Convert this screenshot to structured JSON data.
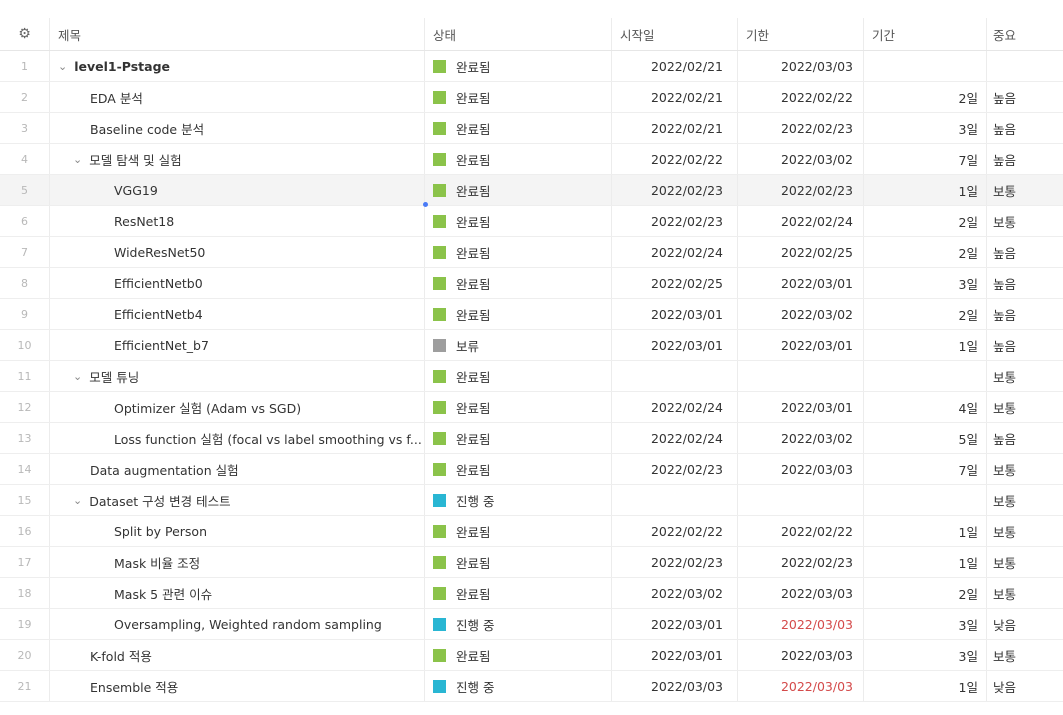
{
  "columns": {
    "settings_icon": "gear-icon",
    "title": "제목",
    "status": "상태",
    "start": "시작일",
    "due": "기한",
    "duration": "기간",
    "priority": "중요"
  },
  "colors": {
    "done": "#8bc34a",
    "hold": "#9e9e9e",
    "progress": "#29b6d3",
    "overdue": "#d44a4a"
  },
  "rows": [
    {
      "num": "1",
      "title": "level1-Pstage",
      "indent": 0,
      "chevron": true,
      "bold": true,
      "status": "완료됨",
      "status_color": "done",
      "start": "2022/02/21",
      "due": "2022/03/03",
      "duration": "",
      "priority": ""
    },
    {
      "num": "2",
      "title": "EDA 분석",
      "indent": 1,
      "chevron": false,
      "status": "완료됨",
      "status_color": "done",
      "start": "2022/02/21",
      "due": "2022/02/22",
      "duration": "2일",
      "priority": "높음"
    },
    {
      "num": "3",
      "title": "Baseline code 분석",
      "indent": 1,
      "chevron": false,
      "status": "완료됨",
      "status_color": "done",
      "start": "2022/02/21",
      "due": "2022/02/23",
      "duration": "3일",
      "priority": "높음"
    },
    {
      "num": "4",
      "title": "모델 탐색 및 실험",
      "indent": 1,
      "chevron": true,
      "status": "완료됨",
      "status_color": "done",
      "start": "2022/02/22",
      "due": "2022/03/02",
      "duration": "7일",
      "priority": "높음"
    },
    {
      "num": "5",
      "title": "VGG19",
      "indent": 2,
      "chevron": false,
      "highlight": true,
      "status": "완료됨",
      "status_color": "done",
      "start": "2022/02/23",
      "due": "2022/02/23",
      "duration": "1일",
      "priority": "보통"
    },
    {
      "num": "6",
      "title": "ResNet18",
      "indent": 2,
      "chevron": false,
      "status": "완료됨",
      "status_color": "done",
      "start": "2022/02/23",
      "due": "2022/02/24",
      "duration": "2일",
      "priority": "보통"
    },
    {
      "num": "7",
      "title": "WideResNet50",
      "indent": 2,
      "chevron": false,
      "status": "완료됨",
      "status_color": "done",
      "start": "2022/02/24",
      "due": "2022/02/25",
      "duration": "2일",
      "priority": "높음"
    },
    {
      "num": "8",
      "title": "EfficientNetb0",
      "indent": 2,
      "chevron": false,
      "status": "완료됨",
      "status_color": "done",
      "start": "2022/02/25",
      "due": "2022/03/01",
      "duration": "3일",
      "priority": "높음"
    },
    {
      "num": "9",
      "title": "EfficientNetb4",
      "indent": 2,
      "chevron": false,
      "status": "완료됨",
      "status_color": "done",
      "start": "2022/03/01",
      "due": "2022/03/02",
      "duration": "2일",
      "priority": "높음"
    },
    {
      "num": "10",
      "title": "EfficientNet_b7",
      "indent": 2,
      "chevron": false,
      "status": "보류",
      "status_color": "hold",
      "start": "2022/03/01",
      "due": "2022/03/01",
      "duration": "1일",
      "priority": "높음"
    },
    {
      "num": "11",
      "title": "모델 튜닝",
      "indent": 1,
      "chevron": true,
      "status": "완료됨",
      "status_color": "done",
      "start": "",
      "due": "",
      "duration": "",
      "priority": "보통"
    },
    {
      "num": "12",
      "title": "Optimizer 실험 (Adam vs SGD)",
      "indent": 2,
      "chevron": false,
      "status": "완료됨",
      "status_color": "done",
      "start": "2022/02/24",
      "due": "2022/03/01",
      "duration": "4일",
      "priority": "보통"
    },
    {
      "num": "13",
      "title": "Loss function 실험 (focal vs label smoothing vs f...",
      "indent": 2,
      "chevron": false,
      "status": "완료됨",
      "status_color": "done",
      "start": "2022/02/24",
      "due": "2022/03/02",
      "duration": "5일",
      "priority": "높음"
    },
    {
      "num": "14",
      "title": "Data augmentation 실험",
      "indent": 1,
      "chevron": false,
      "status": "완료됨",
      "status_color": "done",
      "start": "2022/02/23",
      "due": "2022/03/03",
      "duration": "7일",
      "priority": "보통"
    },
    {
      "num": "15",
      "title": "Dataset 구성 변경 테스트",
      "indent": 1,
      "chevron": true,
      "status": "진행 중",
      "status_color": "progress",
      "start": "",
      "due": "",
      "duration": "",
      "priority": "보통"
    },
    {
      "num": "16",
      "title": "Split by Person",
      "indent": 2,
      "chevron": false,
      "status": "완료됨",
      "status_color": "done",
      "start": "2022/02/22",
      "due": "2022/02/22",
      "duration": "1일",
      "priority": "보통"
    },
    {
      "num": "17",
      "title": "Mask 비율 조정",
      "indent": 2,
      "chevron": false,
      "status": "완료됨",
      "status_color": "done",
      "start": "2022/02/23",
      "due": "2022/02/23",
      "duration": "1일",
      "priority": "보통"
    },
    {
      "num": "18",
      "title": "Mask 5 관련 이슈",
      "indent": 2,
      "chevron": false,
      "status": "완료됨",
      "status_color": "done",
      "start": "2022/03/02",
      "due": "2022/03/03",
      "duration": "2일",
      "priority": "보통"
    },
    {
      "num": "19",
      "title": "Oversampling, Weighted random sampling",
      "indent": 2,
      "chevron": false,
      "status": "진행 중",
      "status_color": "progress",
      "start": "2022/03/01",
      "due": "2022/03/03",
      "due_overdue": true,
      "duration": "3일",
      "priority": "낮음"
    },
    {
      "num": "20",
      "title": "K-fold 적용",
      "indent": 1,
      "chevron": false,
      "status": "완료됨",
      "status_color": "done",
      "start": "2022/03/01",
      "due": "2022/03/03",
      "duration": "3일",
      "priority": "보통"
    },
    {
      "num": "21",
      "title": "Ensemble 적용",
      "indent": 1,
      "chevron": false,
      "status": "진행 중",
      "status_color": "progress",
      "start": "2022/03/03",
      "due": "2022/03/03",
      "due_overdue": true,
      "duration": "1일",
      "priority": "낮음"
    }
  ]
}
